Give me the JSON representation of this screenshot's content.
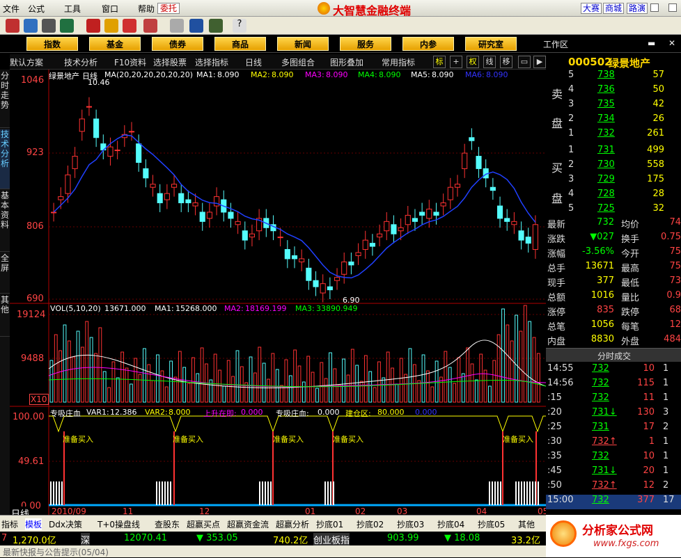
{
  "app": {
    "title": "大智慧金融终端",
    "menus": [
      "文件",
      "公式",
      "工具",
      "窗口",
      "帮助"
    ],
    "wt": "委托",
    "right_buttons": [
      "大赛",
      "商城",
      "路演"
    ]
  },
  "nav": {
    "buttons": [
      "指数",
      "基金",
      "债券",
      "商品",
      "新闻",
      "服务",
      "内参",
      "研究室"
    ],
    "work": "工作区"
  },
  "optbar": {
    "items": [
      "默认方案",
      "技术分析",
      "F10资料",
      "选择股票",
      "选择指标",
      "日线",
      "多图组合",
      "图形叠加",
      "常用指标"
    ],
    "icons": [
      "标",
      "+",
      "权",
      "线",
      "移"
    ]
  },
  "leftbar": {
    "tabs": [
      "分时走势",
      "技术分析",
      "基本资料",
      "全屏",
      "其他"
    ]
  },
  "chart": {
    "stock_label": "绿景地产",
    "period": "日线",
    "ma_header": "MA(20,20,20,20,20,20)",
    "ma": [
      {
        "label": "MA1:",
        "value": "8.090",
        "color": "#ffffff"
      },
      {
        "label": "MA2:",
        "value": "8.090",
        "color": "#ffff00"
      },
      {
        "label": "MA3:",
        "value": "8.090",
        "color": "#ff00ff"
      },
      {
        "label": "MA4:",
        "value": "8.090",
        "color": "#00ff00"
      },
      {
        "label": "MA5:",
        "value": "8.090",
        "color": "#ffffff"
      },
      {
        "label": "MA6:",
        "value": "8.090",
        "color": "#3333ff"
      }
    ],
    "y_labels": [
      "1046",
      "923",
      "806",
      "690"
    ],
    "high_mark": "10.46",
    "low_mark": "6.90",
    "vol_header": "VOL(5,10,20)",
    "vol_value": "13671.000",
    "vol_ma": [
      {
        "label": "MA1:",
        "value": "15268.000",
        "color": "#ffffff"
      },
      {
        "label": "MA2:",
        "value": "18169.199",
        "color": "#ff00ff"
      },
      {
        "label": "MA3:",
        "value": "33890.949",
        "color": "#00ff00"
      }
    ],
    "vol_labels": [
      "19124",
      "9488",
      "X10"
    ],
    "ind_header": "专吸庄血",
    "ind_vals": [
      {
        "label": "VAR1:",
        "value": "12.386",
        "color": "#ffffff"
      },
      {
        "label": "VAR2:",
        "value": "8.000",
        "color": "#ffff00"
      },
      {
        "label": "上升在即:",
        "value": "0.000",
        "color": "#ff00ff"
      },
      {
        "label": "专吸庄血:",
        "value": "0.000",
        "color": "#ffffff"
      },
      {
        "label": "建仓区:",
        "value": "80.000",
        "color": "#ffff00"
      },
      {
        "label": "",
        "value": "0.000",
        "color": "#3333ff"
      }
    ],
    "ind_labels": [
      "100.00",
      "49.61",
      "0.00"
    ],
    "buy_signal": "准备买入",
    "x_labels": [
      "2010/09",
      "11",
      "12",
      "01",
      "02",
      "03",
      "04",
      "05"
    ],
    "bottom_label": "日线"
  },
  "quote": {
    "code": "000502",
    "name": "绿景地产",
    "sell_label": [
      "卖",
      "盘"
    ],
    "buy_label": [
      "买",
      "盘"
    ],
    "sell": [
      [
        "5",
        "738",
        "57"
      ],
      [
        "4",
        "736",
        "50"
      ],
      [
        "3",
        "735",
        "42"
      ],
      [
        "2",
        "734",
        "26"
      ],
      [
        "1",
        "732",
        "261"
      ]
    ],
    "buy": [
      [
        "1",
        "731",
        "499"
      ],
      [
        "2",
        "730",
        "558"
      ],
      [
        "3",
        "729",
        "175"
      ],
      [
        "4",
        "728",
        "28"
      ],
      [
        "5",
        "725",
        "32"
      ]
    ],
    "stats": [
      [
        "最新",
        "732",
        "均价",
        "74"
      ],
      [
        "涨跌",
        "▼027",
        "换手",
        "0.75"
      ],
      [
        "涨幅",
        "-3.56%",
        "今开",
        "75"
      ],
      [
        "总手",
        "13671",
        "最高",
        "75"
      ],
      [
        "现手",
        "377",
        "最低",
        "73"
      ],
      [
        "总额",
        "1016",
        "量比",
        "0.9"
      ],
      [
        "涨停",
        "835",
        "跌停",
        "68"
      ],
      [
        "总笔",
        "1056",
        "每笔",
        "12"
      ],
      [
        "内盘",
        "8830",
        "外盘",
        "484"
      ]
    ],
    "ticks_title": "分时成交",
    "ticks": [
      [
        "14:55",
        "732",
        "10",
        "1"
      ],
      [
        "14:56",
        "732",
        "115",
        "1"
      ],
      [
        ":15",
        "732",
        "11",
        "1"
      ],
      [
        ":20",
        "731↓",
        "130",
        "3"
      ],
      [
        ":25",
        "731",
        "17",
        "2"
      ],
      [
        ":30",
        "732↑",
        "1",
        "1"
      ],
      [
        ":35",
        "732",
        "10",
        "1"
      ],
      [
        ":45",
        "731↓",
        "20",
        "1"
      ],
      [
        ":50",
        "732↑",
        "12",
        "2"
      ],
      [
        "15:00",
        "732",
        "377",
        "17"
      ]
    ]
  },
  "bottom": {
    "tabs": [
      "指标",
      "模板",
      "Ddx决策",
      "T+0操盘线",
      "查股东",
      "超赢买点",
      "超赢资金流",
      "超赢分析",
      "抄底01",
      "抄底02",
      "抄底03",
      "抄底04",
      "抄底05",
      "其他"
    ],
    "ticker": [
      "7",
      "1,270.0亿",
      "深",
      "12070.41",
      "▼ 353.05",
      "740.2亿",
      "创业板指",
      "903.99",
      "▼ 18.08",
      "33.2亿"
    ],
    "status": "最新快报与公告提示(05/04)"
  },
  "logo": {
    "text": "分析家公式网",
    "url": "www.fxgs.com"
  }
}
